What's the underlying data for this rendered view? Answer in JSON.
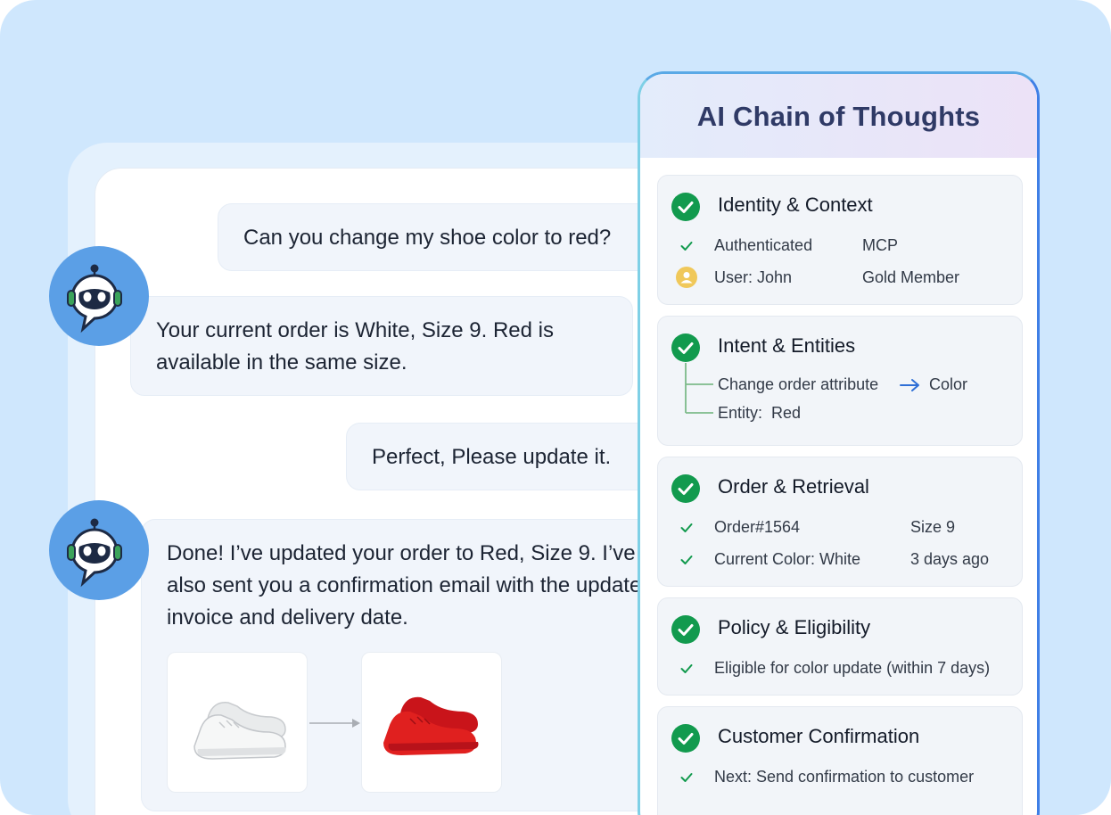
{
  "chat": {
    "messages": [
      {
        "from": "user",
        "text": "Can you change my shoe color to red?"
      },
      {
        "from": "bot",
        "text": "Your current order is White, Size 9. Red is available in the same size."
      },
      {
        "from": "user",
        "text": "Perfect, Please update it."
      },
      {
        "from": "bot",
        "text": "Done! I’ve updated your order to Red, Size 9. I’ve also sent you a confirmation email with the updated invoice and delivery date."
      }
    ],
    "shoes": [
      {
        "color_name": "white",
        "fill": "#f2f2f2"
      },
      {
        "color_name": "red",
        "fill": "#e0201f"
      }
    ]
  },
  "thoughts": {
    "title": "AI Chain of Thoughts",
    "identity": {
      "title": "Identity & Context",
      "authenticated": "Authenticated",
      "protocol": "MCP",
      "user": "User: John",
      "tier": "Gold Member"
    },
    "intent": {
      "title": "Intent & Entities",
      "attribute": "Change order attribute",
      "attribute_value": "Color",
      "entity": "Entity:  Red"
    },
    "order": {
      "title": "Order & Retrieval",
      "order_number": "Order#1564",
      "size": "Size 9",
      "current_color": "Current Color: White",
      "age": "3 days ago"
    },
    "policy": {
      "title": "Policy & Eligibility",
      "eligibility": "Eligible for color update (within 7 days)"
    },
    "confirmation": {
      "title": "Customer Confirmation",
      "next": "Next: Send confirmation to customer"
    }
  },
  "colors": {
    "check_green": "#129a4e",
    "panel_border": "#3f7fe6",
    "avatar_blue": "#5b9fe6",
    "arrow_blue": "#2f6fd6"
  }
}
